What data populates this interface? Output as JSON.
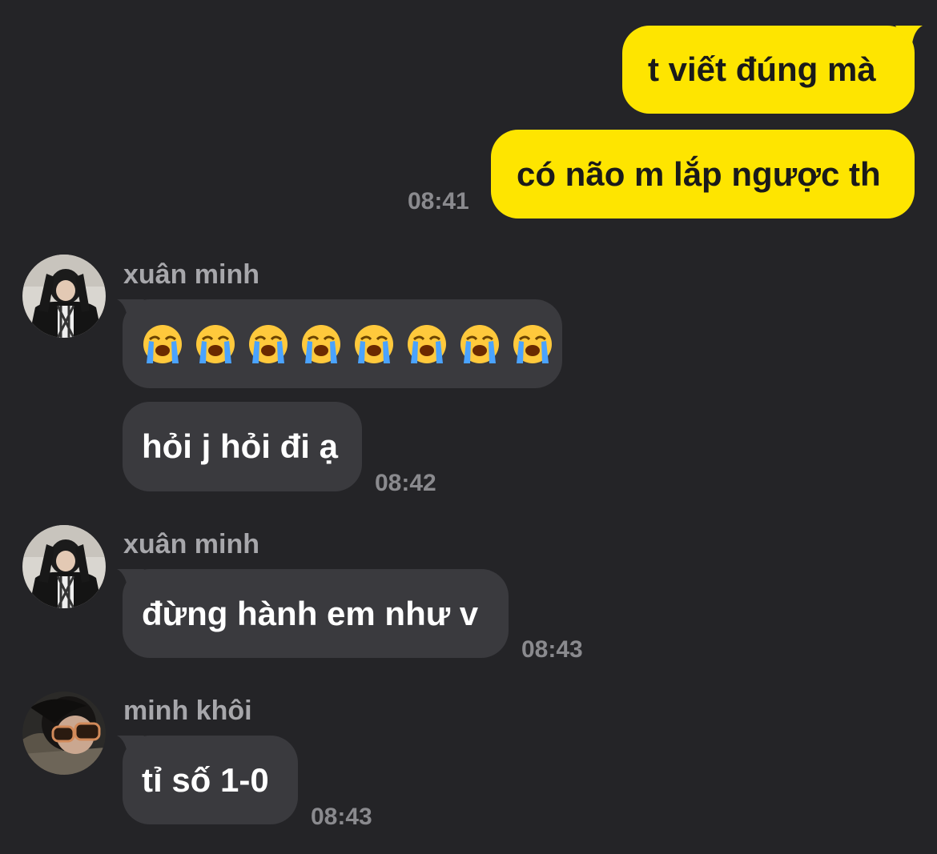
{
  "messages": {
    "out1": "t viết đúng mà",
    "out2": "có não m lắp ngược th",
    "out2_time": "08:41",
    "g1_name": "xuân minh",
    "g1_emoji_count": 8,
    "g1_text": "hỏi j hỏi đi ạ",
    "g1_time": "08:42",
    "g2_name": "xuân minh",
    "g2_text": "đừng hành em như v",
    "g2_time": "08:43",
    "g3_name": "minh khôi",
    "g3_text": "tỉ số 1-0",
    "g3_time": "08:43"
  },
  "colors": {
    "background": "#242427",
    "outgoing_bubble": "#FEE500",
    "incoming_bubble": "#3a3a3e",
    "timestamp": "#8a8a8e",
    "sender_name": "#a7a7ab"
  },
  "icons": {
    "emoji": "loudly-crying-face"
  }
}
